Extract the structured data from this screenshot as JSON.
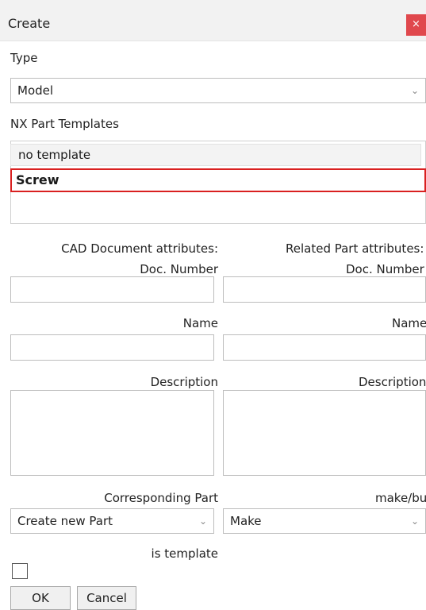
{
  "window": {
    "title": "Create",
    "close_symbol": "×"
  },
  "type": {
    "label": "Type",
    "selected": "Model"
  },
  "templates": {
    "label": "NX Part Templates",
    "items": [
      "no template",
      "Screw"
    ]
  },
  "cad": {
    "header": "CAD Document attributes:",
    "doc_number_label": "Doc. Number",
    "name_label": "Name",
    "description_label": "Description"
  },
  "related": {
    "header": "Related Part attributes:",
    "doc_number_label": "Doc. Number",
    "name_label": "Name",
    "description_label": "Description"
  },
  "corresponding_part": {
    "label": "Corresponding Part",
    "selected": "Create new Part"
  },
  "make_buy": {
    "label": "make/buy",
    "selected": "Make"
  },
  "is_template": {
    "label": "is template",
    "checked": false
  },
  "buttons": {
    "ok": "OK",
    "cancel": "Cancel"
  },
  "icons": {
    "close": "close-icon",
    "dropdown": "chevron-down-icon",
    "chevron_glyph": "⌄"
  },
  "colors": {
    "close_bg": "#e0484d",
    "selection_border": "#d92020",
    "title_bg": "#f2f2f2"
  }
}
